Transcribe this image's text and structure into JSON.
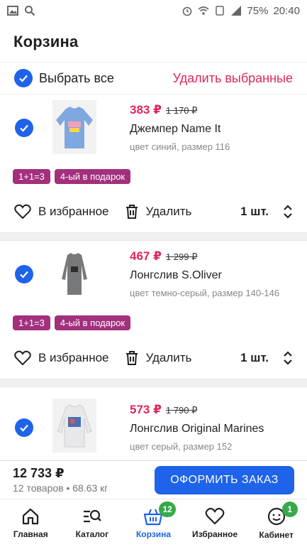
{
  "status": {
    "time": "20:40",
    "battery": "75%"
  },
  "header": {
    "title": "Корзина"
  },
  "selection": {
    "select_all": "Выбрать все",
    "delete_selected": "Удалить выбранные"
  },
  "products": [
    {
      "price": "383 ₽",
      "old_price": "1 170 ₽",
      "name": "Джемпер Name It",
      "attrs": "цвет синий, размер 116",
      "badges": [
        "1+1=3",
        "4-ый в подарок"
      ],
      "favorite": "В избранное",
      "remove": "Удалить",
      "qty": "1 шт.",
      "image": "blue-sweater"
    },
    {
      "price": "467 ₽",
      "old_price": "1 299 ₽",
      "name": "Лонгслив S.Oliver",
      "attrs": "цвет темно-серый, размер 140-146",
      "badges": [
        "1+1=3",
        "4-ый в подарок"
      ],
      "favorite": "В избранное",
      "remove": "Удалить",
      "qty": "1 шт.",
      "image": "gray-longsleeve"
    },
    {
      "price": "573 ₽",
      "old_price": "1 790 ₽",
      "name": "Лонгслив Original Marines",
      "attrs": "цвет серый, размер 152",
      "image": "white-longsleeve"
    }
  ],
  "checkout": {
    "total": "12 733 ₽",
    "summary": "12 товаров • 68.63 кг",
    "button": "ОФОРМИТЬ ЗАКАЗ"
  },
  "nav": [
    {
      "label": "Главная",
      "icon": "home-icon"
    },
    {
      "label": "Каталог",
      "icon": "catalog-search-icon"
    },
    {
      "label": "Корзина",
      "icon": "basket-icon",
      "badge": "12",
      "active": true
    },
    {
      "label": "Избранное",
      "icon": "heart-icon"
    },
    {
      "label": "Кабинет",
      "icon": "smiley-icon",
      "badge": "1"
    }
  ],
  "colors": {
    "accent": "#1e63e9",
    "sale": "#e0265c",
    "promo": "#a3307d",
    "badge": "#37a94a"
  }
}
